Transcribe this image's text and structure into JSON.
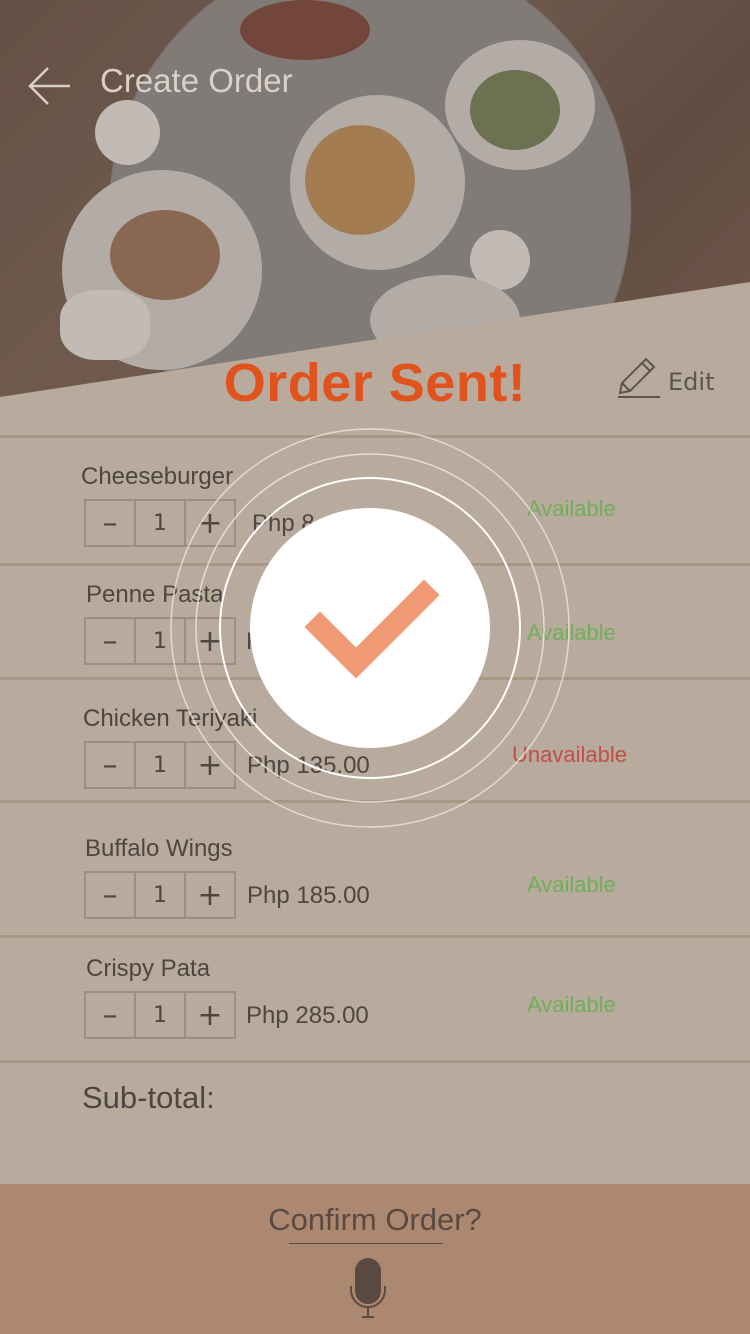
{
  "header": {
    "title": "Create Order",
    "back_icon": "arrow-left-icon"
  },
  "status_title": "Order Sent!",
  "edit": {
    "label": "Edit",
    "icon": "pencil-icon"
  },
  "items": [
    {
      "name": "Cheeseburger",
      "quantity": "1",
      "price": "Php 8",
      "status": "Available"
    },
    {
      "name": "Penne Pasta",
      "quantity": "1",
      "price": "P",
      "status": "Available"
    },
    {
      "name": "Chicken Teriyaki",
      "quantity": "1",
      "price": "Php 135.00",
      "status": "Unavailable"
    },
    {
      "name": "Buffalo Wings",
      "quantity": "1",
      "price": "Php 185.00",
      "status": "Available"
    },
    {
      "name": "Crispy Pata",
      "quantity": "1",
      "price": "Php 285.00",
      "status": "Available"
    }
  ],
  "stepper": {
    "minus": "–",
    "plus": "+"
  },
  "subtotal_label": "Sub-total:",
  "footer": {
    "confirm_label": "Confirm Order?",
    "mic_icon": "microphone-icon"
  },
  "colors": {
    "accent": "#e0531c",
    "available": "#6fae5a",
    "unavailable": "#c0504a",
    "footer": "#ad8870",
    "check": "#ef9a74"
  },
  "overlay": {
    "icon": "checkmark-icon"
  }
}
